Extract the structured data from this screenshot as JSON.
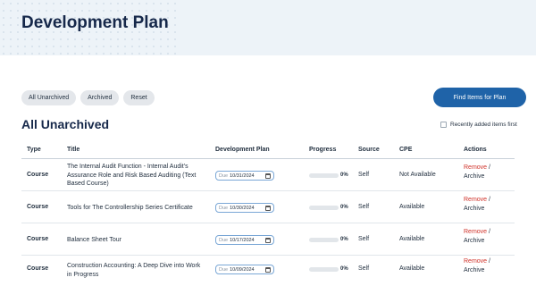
{
  "page": {
    "title": "Development Plan"
  },
  "filters": {
    "all_unarchived": "All Unarchived",
    "archived": "Archived",
    "reset": "Reset"
  },
  "find_button": "Find Items for Plan",
  "section_title": "All Unarchived",
  "recent_label": "Recently added items first",
  "columns": [
    "Type",
    "Title",
    "Development Plan",
    "Progress",
    "Source",
    "CPE",
    "Actions"
  ],
  "due_label": "Due",
  "rows": [
    {
      "type": "Course",
      "title": "The Internal Audit Function - Internal Audit's Assurance Role and Risk Based Auditing (Text Based Course)",
      "due_date": "10/31/2024",
      "progress": 0,
      "progress_text": "0%",
      "source": "Self",
      "cpe": "Not Available",
      "remove": "Remove",
      "sep": " /",
      "archive": "Archive"
    },
    {
      "type": "Course",
      "title": "Tools for The Controllership Series Certificate",
      "due_date": "10/30/2024",
      "progress": 0,
      "progress_text": "0%",
      "source": "Self",
      "cpe": "Available",
      "remove": "Remove",
      "sep": " /",
      "archive": "Archive"
    },
    {
      "type": "Course",
      "title": "Balance Sheet Tour",
      "due_date": "10/17/2024",
      "progress": 0,
      "progress_text": "0%",
      "source": "Self",
      "cpe": "Available",
      "remove": "Remove",
      "sep": " /",
      "archive": "Archive"
    },
    {
      "type": "Course",
      "title": "Construction Accounting: A Deep Dive into Work in Progress",
      "due_date": "10/09/2024",
      "progress": 0,
      "progress_text": "0%",
      "source": "Self",
      "cpe": "Available",
      "remove": "Remove",
      "sep": " /",
      "archive": "Archive"
    }
  ],
  "colors": {
    "brand": "#1f63a8",
    "title": "#16284a",
    "remove": "#d0342c",
    "header_bg": "#edf3f8"
  },
  "icons": {
    "calendar": "calendar-icon",
    "checkbox": "checkbox-icon"
  }
}
